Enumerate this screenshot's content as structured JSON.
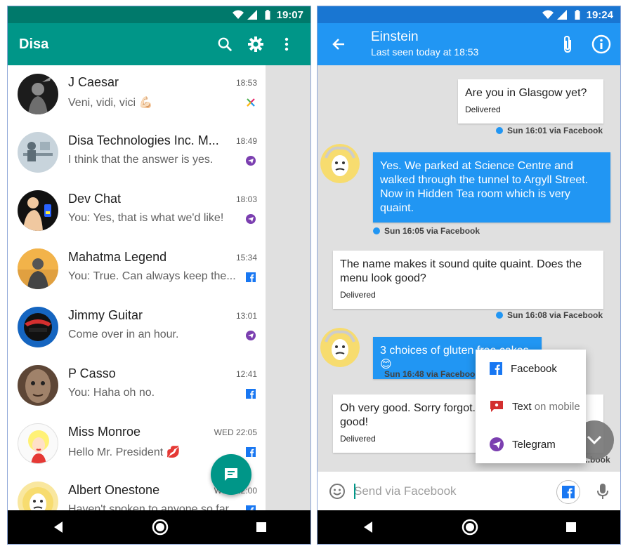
{
  "left": {
    "status_time": "19:07",
    "app_title": "Disa",
    "chats": [
      {
        "name": "J Caesar",
        "message": "Veni, vidi, vici 💪🏻",
        "time": "18:53",
        "source_icon": "disa-x-icon"
      },
      {
        "name": "Disa Technologies Inc. M...",
        "message": "I think that the answer is yes.",
        "time": "18:49",
        "source_icon": "telegram-icon"
      },
      {
        "name": "Dev Chat",
        "message": "You: Yes, that is what we'd like!",
        "time": "18:03",
        "source_icon": "telegram-icon"
      },
      {
        "name": "Mahatma Legend",
        "message": "You: True. Can always keep the...",
        "time": "15:34",
        "source_icon": "facebook-icon"
      },
      {
        "name": "Jimmy Guitar",
        "message": "Come over in an hour.",
        "time": "13:01",
        "source_icon": "telegram-icon"
      },
      {
        "name": "P Casso",
        "message": "You: Haha oh no.",
        "time": "12:41",
        "source_icon": "facebook-icon"
      },
      {
        "name": "Miss Monroe",
        "message": "Hello Mr. President 💋",
        "time": "WED 22:05",
        "source_icon": "facebook-icon"
      },
      {
        "name": "Albert Onestone",
        "message": "Haven't spoken to anyone so far",
        "time": "WED 22:00",
        "source_icon": "facebook-icon"
      }
    ]
  },
  "right": {
    "status_time": "19:24",
    "contact_name": "Einstein",
    "contact_status": "Last seen today at 18:53",
    "messages": [
      {
        "text": "Are you in Glasgow yet?",
        "status": "Delivered"
      },
      {
        "meta": "Sun 16:01 via Facebook"
      },
      {
        "text": "Yes. We parked at Science Centre and walked through the tunnel to Argyll Street. Now in Hidden Tea room which is very quaint."
      },
      {
        "meta": "Sun 16:05 via Facebook"
      },
      {
        "text": "The name makes it sound quite quaint. Does the menu look good?",
        "status": "Delivered"
      },
      {
        "meta": "Sun 16:08 via Facebook"
      },
      {
        "text": "3 choices of gluten free cakes 😊"
      },
      {
        "meta": "Sun 16:48 via Facebook"
      },
      {
        "text": "Oh very good. Sorry forgot... Hope the show is good!",
        "status": "Delivered"
      },
      {
        "meta": "...book"
      }
    ],
    "send_options": [
      {
        "label": "Facebook",
        "suffix": ""
      },
      {
        "label": "Text",
        "suffix": "on mobile"
      },
      {
        "label": "Telegram",
        "suffix": ""
      }
    ],
    "input_placeholder": "Send via Facebook"
  },
  "colors": {
    "teal": "#009688",
    "teal_dark": "#00796b",
    "blue": "#2196f3",
    "blue_dark": "#1976d2",
    "telegram": "#7b3fb0",
    "facebook": "#1877f2"
  }
}
